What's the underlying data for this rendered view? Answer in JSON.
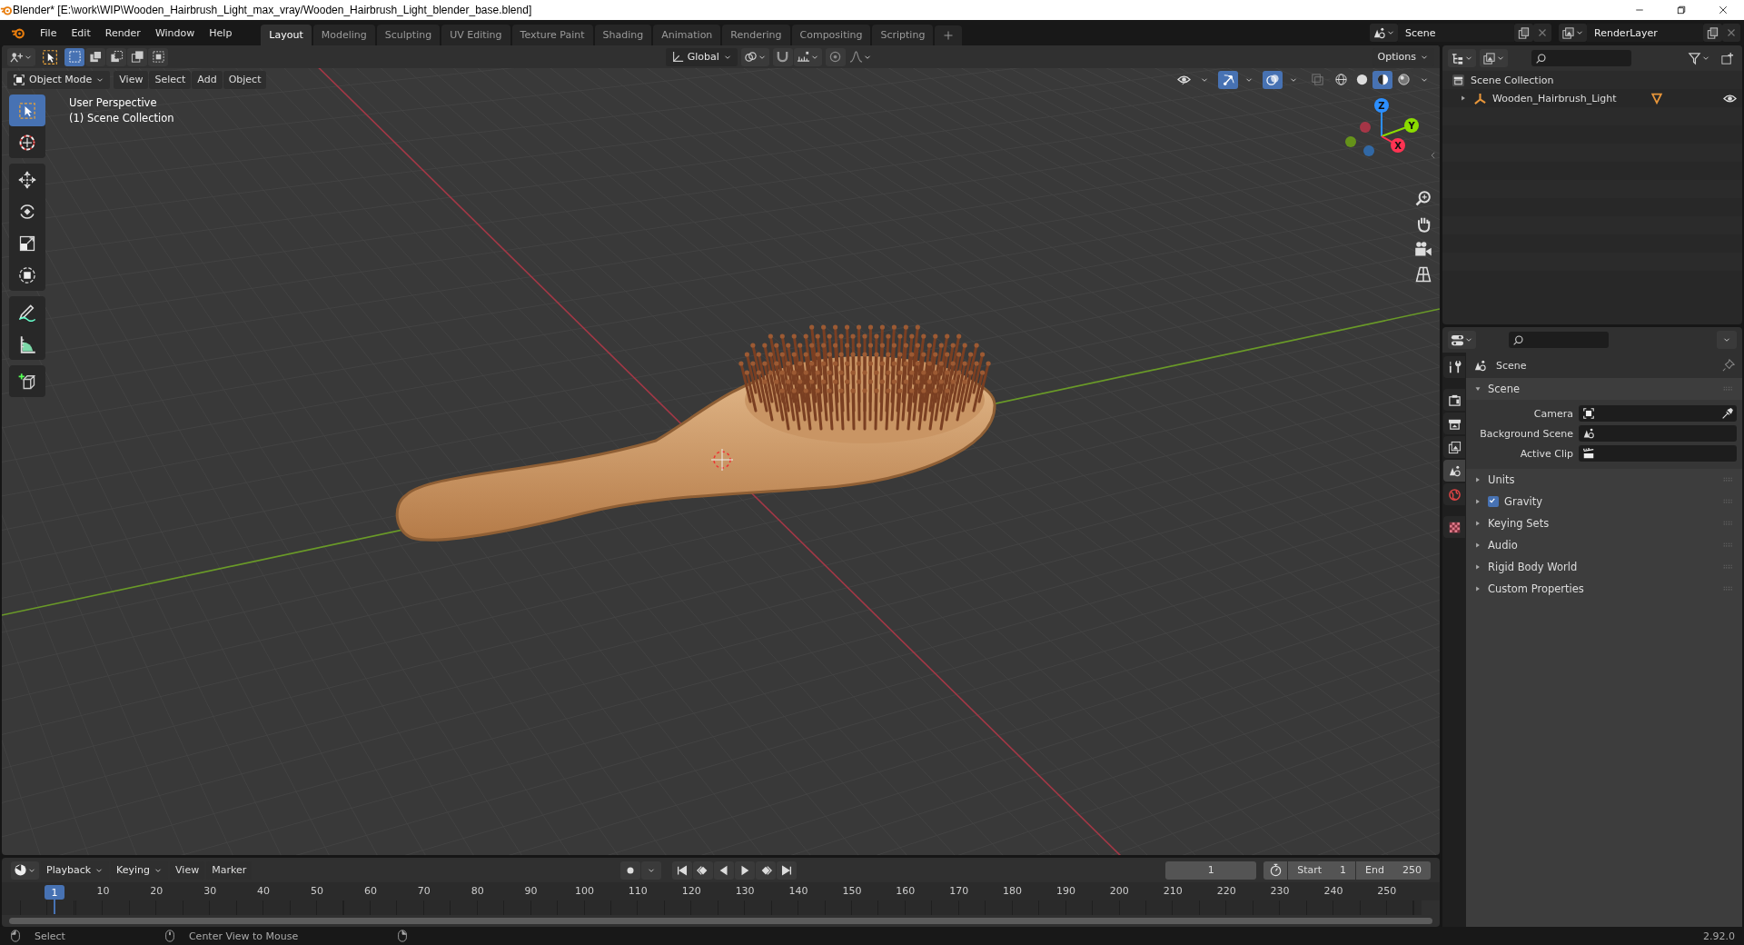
{
  "window": {
    "title": "Blender* [E:\\work\\WIP\\Wooden_Hairbrush_Light_max_vray/Wooden_Hairbrush_Light_blender_base.blend]"
  },
  "menu": [
    "File",
    "Edit",
    "Render",
    "Window",
    "Help"
  ],
  "workspaces": [
    {
      "label": "Layout",
      "selected": true
    },
    {
      "label": "Modeling",
      "selected": false
    },
    {
      "label": "Sculpting",
      "selected": false
    },
    {
      "label": "UV Editing",
      "selected": false
    },
    {
      "label": "Texture Paint",
      "selected": false
    },
    {
      "label": "Shading",
      "selected": false
    },
    {
      "label": "Animation",
      "selected": false
    },
    {
      "label": "Rendering",
      "selected": false
    },
    {
      "label": "Compositing",
      "selected": false
    },
    {
      "label": "Scripting",
      "selected": false
    }
  ],
  "scene_selector": {
    "value": "Scene"
  },
  "view_layer_selector": {
    "value": "RenderLayer"
  },
  "viewport": {
    "select_modes": [
      {
        "kind": "new",
        "selected": true
      },
      {
        "kind": "extend",
        "selected": false
      },
      {
        "kind": "subtract",
        "selected": false
      },
      {
        "kind": "invert",
        "selected": false
      },
      {
        "kind": "intersect",
        "selected": false
      }
    ],
    "orientation": "Global",
    "options": "Options",
    "mode": "Object Mode",
    "menus": [
      "View",
      "Select",
      "Add",
      "Object"
    ],
    "toggles": [
      {
        "kind": "visibility",
        "on": false
      },
      {
        "kind": "gizmo",
        "on": true
      },
      {
        "kind": "overlay",
        "on": true
      },
      {
        "kind": "xray",
        "on": false
      }
    ],
    "shading": [
      {
        "kind": "wireframe",
        "selected": false
      },
      {
        "kind": "solid",
        "selected": false
      },
      {
        "kind": "material",
        "selected": true
      },
      {
        "kind": "rendered",
        "selected": false
      }
    ],
    "info": [
      "User Perspective",
      "(1) Scene Collection"
    ],
    "gizmo_axes": [
      {
        "label": "Z",
        "color": "#2c8fff"
      },
      {
        "label": "Y",
        "color": "#8bdc00"
      },
      {
        "label": "X",
        "color": "#ff3352"
      }
    ],
    "tool_groups": [
      {
        "tools": [
          {
            "kind": "select",
            "selected": true
          },
          {
            "kind": "cursor",
            "selected": false
          }
        ]
      },
      {
        "tools": [
          {
            "kind": "move",
            "selected": false
          },
          {
            "kind": "rotate",
            "selected": false
          },
          {
            "kind": "scale",
            "selected": false
          },
          {
            "kind": "transform",
            "selected": false
          }
        ]
      },
      {
        "tools": [
          {
            "kind": "annotate",
            "selected": false
          },
          {
            "kind": "measure",
            "selected": false
          }
        ]
      },
      {
        "tools": [
          {
            "kind": "add_cube",
            "selected": false
          }
        ]
      }
    ]
  },
  "outliner": {
    "root": "Scene Collection",
    "items": [
      {
        "label": "Wooden_Hairbrush_Light",
        "expanded": false
      }
    ]
  },
  "properties": {
    "tabs": [
      {
        "kind": "tool",
        "selected": false
      },
      {
        "kind": "render",
        "selected": false
      },
      {
        "kind": "output",
        "selected": false
      },
      {
        "kind": "view_layer",
        "selected": false
      },
      {
        "kind": "scene",
        "selected": true
      },
      {
        "kind": "world",
        "selected": false
      },
      {
        "kind": "texture",
        "selected": false
      }
    ],
    "context": "Scene",
    "panel": {
      "label": "Scene",
      "expanded": true,
      "fields": [
        {
          "label": "Camera",
          "kind": "camera"
        },
        {
          "label": "Background Scene",
          "kind": "scene"
        },
        {
          "label": "Active Clip",
          "kind": "clip"
        }
      ]
    },
    "subpanels": [
      {
        "label": "Units",
        "kind": "plain",
        "expanded": false
      },
      {
        "label": "Gravity",
        "kind": "checkbox",
        "checked": true,
        "expanded": false
      },
      {
        "label": "Keying Sets",
        "kind": "plain",
        "expanded": false
      },
      {
        "label": "Audio",
        "kind": "plain",
        "expanded": false
      },
      {
        "label": "Rigid Body World",
        "kind": "plain",
        "expanded": false
      },
      {
        "label": "Custom Properties",
        "kind": "plain",
        "expanded": false
      }
    ]
  },
  "timeline": {
    "menus": [
      {
        "label": "Playback",
        "kind": "dropdown"
      },
      {
        "label": "Keying",
        "kind": "dropdown"
      },
      {
        "label": "View",
        "kind": "menu"
      },
      {
        "label": "Marker",
        "kind": "menu"
      }
    ],
    "current_frame": "1",
    "start_label": "Start",
    "start": "1",
    "end_label": "End",
    "end": "250",
    "playhead": "1",
    "ruler": [
      "10",
      "20",
      "30",
      "40",
      "50",
      "60",
      "70",
      "80",
      "90",
      "100",
      "110",
      "120",
      "130",
      "140",
      "150",
      "160",
      "170",
      "180",
      "190",
      "200",
      "210",
      "220",
      "230",
      "240",
      "250"
    ]
  },
  "status_bar": {
    "hints": [
      {
        "kind": "mouse_left",
        "label": "Select"
      },
      {
        "kind": "mouse_middle",
        "label": "Center View to Mouse"
      },
      {
        "kind": "mouse_right"
      }
    ],
    "version": "2.92.0"
  }
}
